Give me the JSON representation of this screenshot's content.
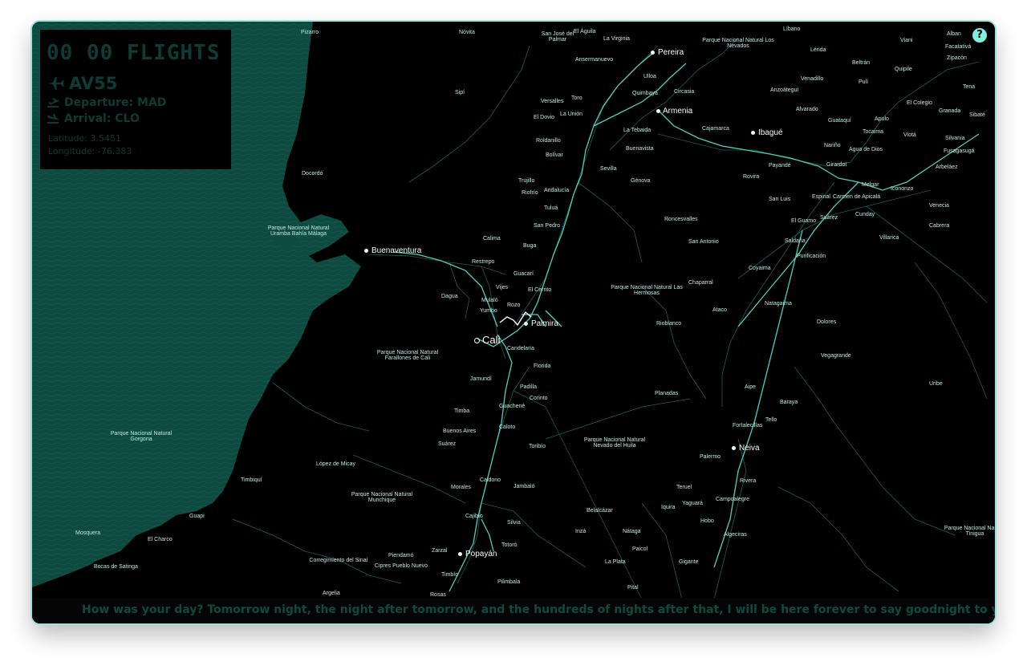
{
  "panel": {
    "title": "00 00 FLIGHTS",
    "flight_code": "AV55",
    "departure": "Departure: MAD",
    "arrival": "Arrival: CLO",
    "latitude": "Latitude: 3.5451",
    "longitude": "Longitude: -76.383"
  },
  "help_label": "?",
  "ticker_text": "How was your day? Tomorrow night, the night after tomorrow, and the hundreds of nights after that, I will be here forever to say goodnight to you. Wherever",
  "icons": {
    "flight": "airplane-icon",
    "departure": "takeoff-icon",
    "arrival": "landing-icon",
    "help": "help-icon"
  },
  "colors": {
    "ocean": "#0f4a40",
    "land": "#000000",
    "road": "#1f7a6b",
    "highway": "#58d6c4",
    "panel_text": "#0e3b33",
    "accent": "#7ef0df"
  },
  "map": {
    "major_cities": [
      {
        "name": "Cali"
      },
      {
        "name": "Palmira"
      },
      {
        "name": "Buenaventura"
      },
      {
        "name": "Popayán"
      },
      {
        "name": "Armenia"
      },
      {
        "name": "Pereira"
      },
      {
        "name": "Ibagué"
      },
      {
        "name": "Neiva"
      }
    ],
    "places": [
      "Pizarro",
      "Nóvita",
      "San José del Palmar",
      "El Águila",
      "La Virginia",
      "Líbano",
      "Alban",
      "Viani",
      "Facatativá",
      "Zipacón",
      "Parque Nacional Natural Los Nevados",
      "Lérida",
      "Beltrán",
      "Quipile",
      "Pulí",
      "Venadillo",
      "Tena",
      "El Colegio",
      "Granada",
      "Sibaté",
      "Sipí",
      "Versalles",
      "Toro",
      "El Dovio",
      "La Unión",
      "Ansermanuevo",
      "Ulloa",
      "Circasia",
      "Quimbaya",
      "La Tebaida",
      "Cajamarca",
      "Anzoátegui",
      "Alvarado",
      "Guataquí",
      "Apulo",
      "Tocaima",
      "Viotá",
      "Silvania",
      "Fusagasugá",
      "Nariño",
      "Agua de Dios",
      "Arbeláez",
      "Roldanillo",
      "Bolívar",
      "Buenavista",
      "Sevilla",
      "Génova",
      "Trujillo",
      "Riofrío",
      "Andalucía",
      "Tuluá",
      "Rovira",
      "Payandé",
      "Girardot",
      "Melgar",
      "Icononzo",
      "Espinal",
      "Carmen de Apicalá",
      "Venecia",
      "San Luis",
      "El Guamo",
      "Suárez",
      "Cunday",
      "Cabrera",
      "Villarica",
      "Roncesvalles",
      "San Antonio",
      "Saldaña",
      "Purificación",
      "Coyaima",
      "Chaparral",
      "Natagaima",
      "Ataco",
      "Dolores",
      "Rioblanco",
      "Parque Nacional Natural Las Hermosas",
      "Vegagrande",
      "Docordó",
      "Parque Nacional Natural Uramba Bahía Málaga",
      "Calima",
      "Buga",
      "San Pedro",
      "Restrepo",
      "Guacarí",
      "El Cerrito",
      "Vijes",
      "Dagua",
      "Mulaló",
      "Yumbo",
      "Rozo",
      "Candelaria",
      "Florida",
      "Parque Nacional Natural Farallones de Cali",
      "Jamundí",
      "Padilla",
      "Corinto",
      "Timba",
      "Guachené",
      "Caloto",
      "Buenos Aires",
      "Suárez",
      "Toribío",
      "Planadas",
      "Aipe",
      "Baraya",
      "Tello",
      "Fortalecillas",
      "Uribe",
      "Parque Nacional Natural Nevado del Huila",
      "Palermo",
      "Rivera",
      "Teruel",
      "Iquira",
      "Yaguará",
      "Campoalegre",
      "Hobo",
      "Algeciras",
      "Parque Nacional Natural Gorgona",
      "López de Micay",
      "Timbiquí",
      "Parque Nacional Natural Munchique",
      "Morales",
      "Caldono",
      "Jambaló",
      "Cajibío",
      "Silvia",
      "Belalcázar",
      "Inzá",
      "Nátaga",
      "Paicol",
      "La Plata",
      "Gigante",
      "Pital",
      "Guapi",
      "Mosquera",
      "El Charco",
      "Bocas de Satinga",
      "Corregimiento del Sinaí",
      "Piendamó",
      "Cipres Pueblo Nuevo",
      "Timbío",
      "Totoró",
      "Pilimbala",
      "Argelia",
      "Rosas",
      "Zarzal",
      "Parque Nacional Natural Tinigua"
    ]
  }
}
